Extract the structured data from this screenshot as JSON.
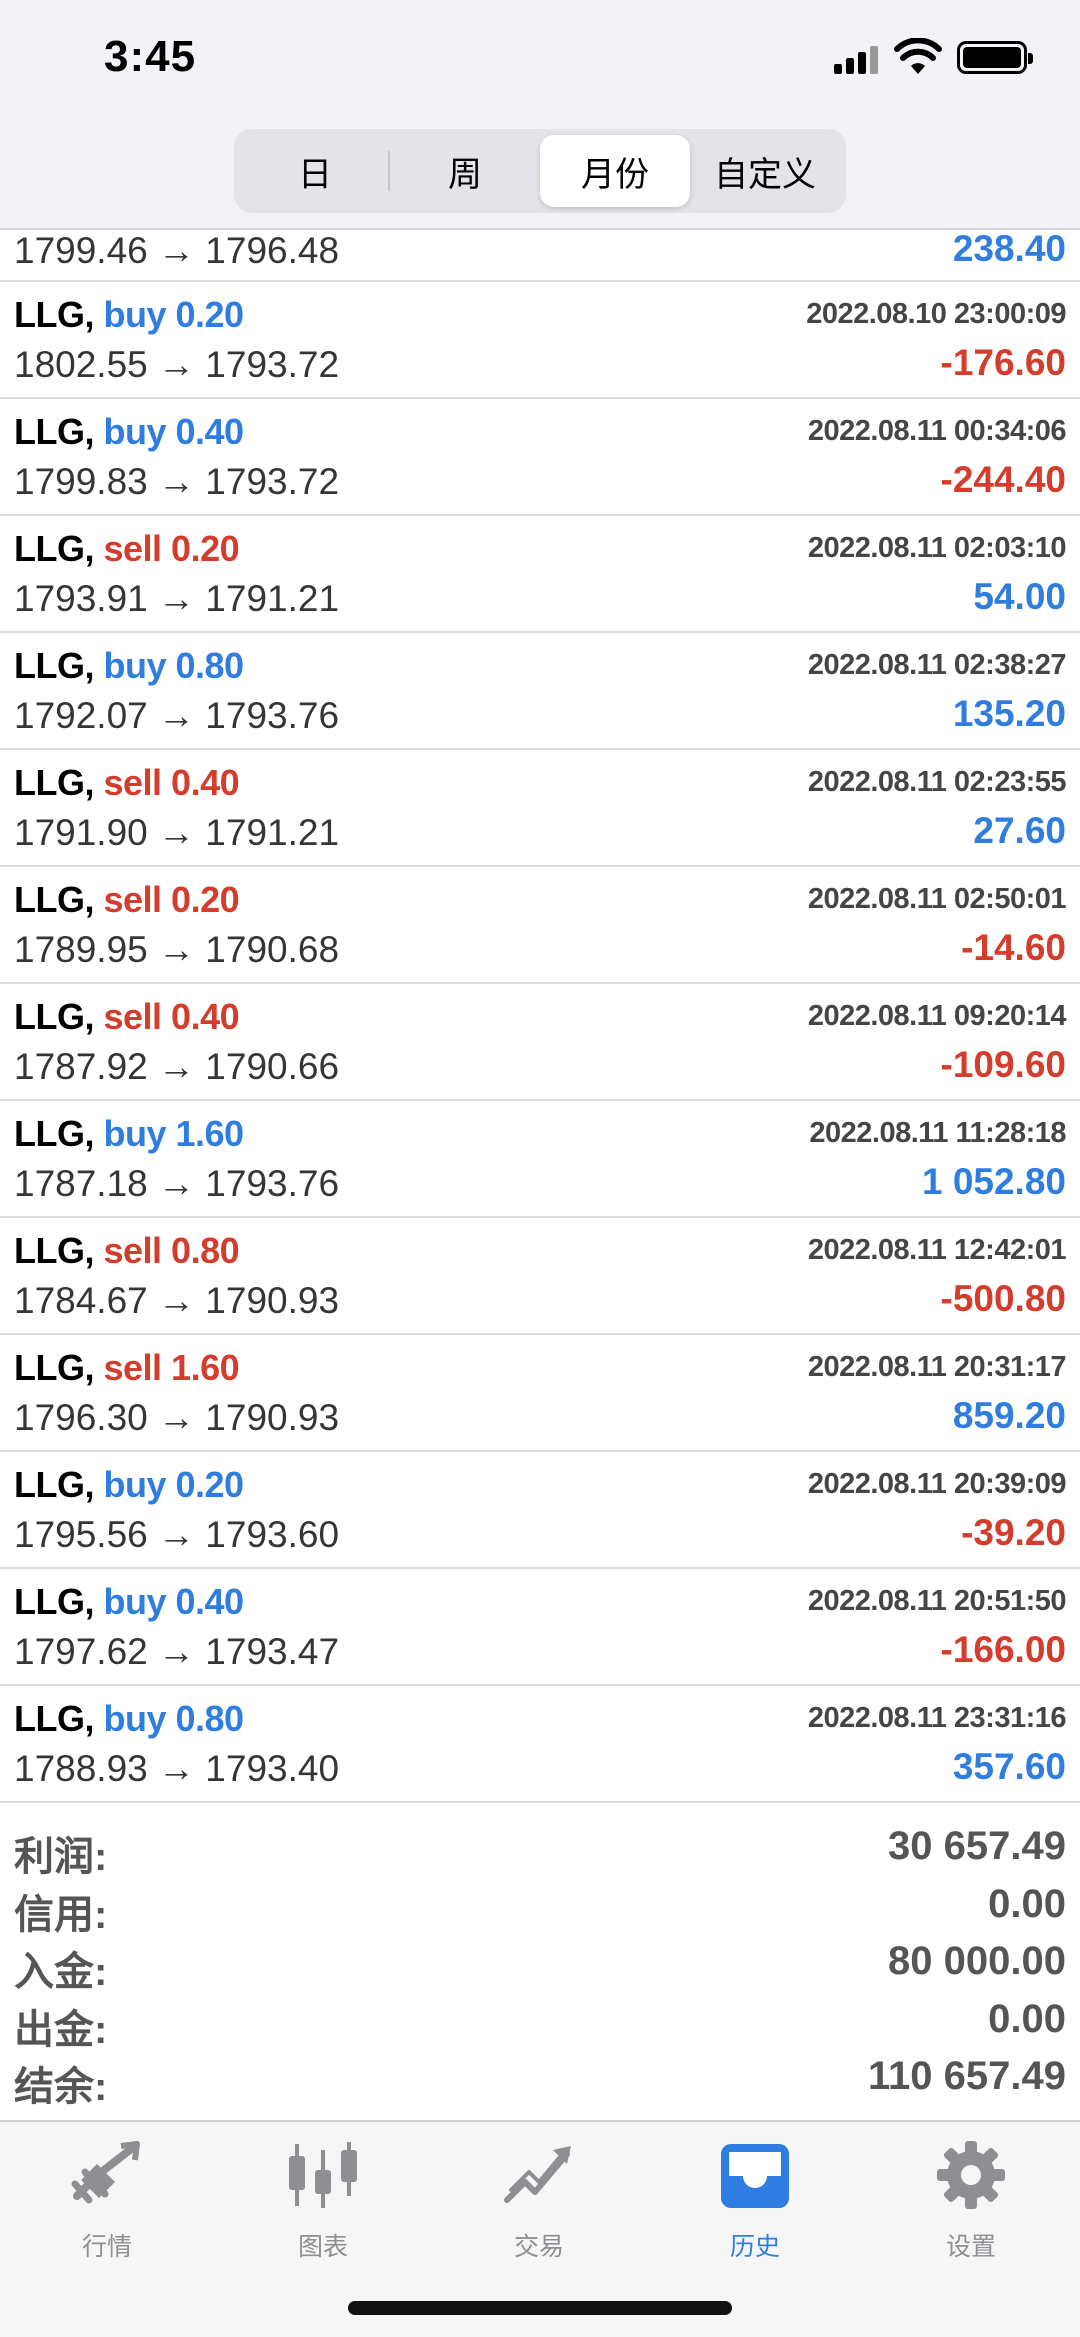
{
  "status": {
    "time": "3:45"
  },
  "segments": [
    {
      "label": "日",
      "active": false
    },
    {
      "label": "周",
      "active": false
    },
    {
      "label": "月份",
      "active": true
    },
    {
      "label": "自定义",
      "active": false
    }
  ],
  "partial_row": {
    "prices": "1799.46 → 1796.48",
    "profit": "238.40",
    "profit_color": "buy"
  },
  "rows": [
    {
      "symbol": "LLG,",
      "side": "buy",
      "volume": "buy 0.20",
      "datetime": "2022.08.10 23:00:09",
      "prices": "1802.55 → 1793.72",
      "profit": "-176.60",
      "profit_color": "sell"
    },
    {
      "symbol": "LLG,",
      "side": "buy",
      "volume": "buy 0.40",
      "datetime": "2022.08.11 00:34:06",
      "prices": "1799.83 → 1793.72",
      "profit": "-244.40",
      "profit_color": "sell"
    },
    {
      "symbol": "LLG,",
      "side": "sell",
      "volume": "sell 0.20",
      "datetime": "2022.08.11 02:03:10",
      "prices": "1793.91 → 1791.21",
      "profit": "54.00",
      "profit_color": "buy"
    },
    {
      "symbol": "LLG,",
      "side": "buy",
      "volume": "buy 0.80",
      "datetime": "2022.08.11 02:38:27",
      "prices": "1792.07 → 1793.76",
      "profit": "135.20",
      "profit_color": "buy"
    },
    {
      "symbol": "LLG,",
      "side": "sell",
      "volume": "sell 0.40",
      "datetime": "2022.08.11 02:23:55",
      "prices": "1791.90 → 1791.21",
      "profit": "27.60",
      "profit_color": "buy"
    },
    {
      "symbol": "LLG,",
      "side": "sell",
      "volume": "sell 0.20",
      "datetime": "2022.08.11 02:50:01",
      "prices": "1789.95 → 1790.68",
      "profit": "-14.60",
      "profit_color": "sell"
    },
    {
      "symbol": "LLG,",
      "side": "sell",
      "volume": "sell 0.40",
      "datetime": "2022.08.11 09:20:14",
      "prices": "1787.92 → 1790.66",
      "profit": "-109.60",
      "profit_color": "sell"
    },
    {
      "symbol": "LLG,",
      "side": "buy",
      "volume": "buy 1.60",
      "datetime": "2022.08.11 11:28:18",
      "prices": "1787.18 → 1793.76",
      "profit": "1 052.80",
      "profit_color": "buy"
    },
    {
      "symbol": "LLG,",
      "side": "sell",
      "volume": "sell 0.80",
      "datetime": "2022.08.11 12:42:01",
      "prices": "1784.67 → 1790.93",
      "profit": "-500.80",
      "profit_color": "sell"
    },
    {
      "symbol": "LLG,",
      "side": "sell",
      "volume": "sell 1.60",
      "datetime": "2022.08.11 20:31:17",
      "prices": "1796.30 → 1790.93",
      "profit": "859.20",
      "profit_color": "buy"
    },
    {
      "symbol": "LLG,",
      "side": "buy",
      "volume": "buy 0.20",
      "datetime": "2022.08.11 20:39:09",
      "prices": "1795.56 → 1793.60",
      "profit": "-39.20",
      "profit_color": "sell"
    },
    {
      "symbol": "LLG,",
      "side": "buy",
      "volume": "buy 0.40",
      "datetime": "2022.08.11 20:51:50",
      "prices": "1797.62 → 1793.47",
      "profit": "-166.00",
      "profit_color": "sell"
    },
    {
      "symbol": "LLG,",
      "side": "buy",
      "volume": "buy 0.80",
      "datetime": "2022.08.11 23:31:16",
      "prices": "1788.93 → 1793.40",
      "profit": "357.60",
      "profit_color": "buy"
    }
  ],
  "summary": [
    {
      "label": "利润:",
      "value": "30 657.49"
    },
    {
      "label": "信用:",
      "value": "0.00"
    },
    {
      "label": "入金:",
      "value": "80 000.00"
    },
    {
      "label": "出金:",
      "value": "0.00"
    },
    {
      "label": "结余:",
      "value": "110 657.49"
    }
  ],
  "tabs": [
    {
      "label": "行情",
      "icon": "quotes-icon",
      "active": false
    },
    {
      "label": "图表",
      "icon": "chart-icon",
      "active": false
    },
    {
      "label": "交易",
      "icon": "trade-icon",
      "active": false
    },
    {
      "label": "历史",
      "icon": "history-icon",
      "active": true
    },
    {
      "label": "设置",
      "icon": "settings-icon",
      "active": false
    }
  ],
  "colors": {
    "buy": "#2f7de1",
    "sell": "#d43c2c",
    "tab_active": "#2f7de1",
    "tab_inactive": "#8e8e93"
  }
}
